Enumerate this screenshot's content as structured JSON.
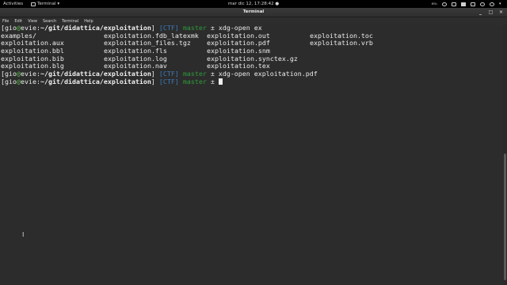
{
  "topbar": {
    "activities": "Activities",
    "app_name": "Terminal",
    "app_caret": "▾",
    "clock": "mar dic 12, 17:28:42",
    "clock_dot": "●",
    "keyboard": "en₁",
    "icons": [
      "network-icon",
      "volume-icon",
      "screenshot-icon",
      "display-icon",
      "user-icon",
      "power-icon",
      "menu-caret-icon"
    ]
  },
  "window": {
    "title": "Terminal",
    "controls": [
      "_",
      "□",
      "✕"
    ]
  },
  "menubar": [
    "File",
    "Edit",
    "View",
    "Search",
    "Terminal",
    "Help"
  ],
  "terminal": {
    "prompt": {
      "open": "[",
      "user": "gio",
      "at": "@",
      "host": "evie",
      "colon": ":",
      "path": "~/git/didattica/exploitation",
      "close": "]",
      "ctf": "[CTF]",
      "branch": "master",
      "symbol": "±"
    },
    "commands": [
      "xdg-open ex",
      "xdg-open exploitation.pdf"
    ],
    "completions": [
      [
        "examples/",
        "exploitation.fdb_latexmk",
        "exploitation.out",
        "exploitation.toc"
      ],
      [
        "exploitation.aux",
        "exploitation_files.tgz",
        "exploitation.pdf",
        "exploitation.vrb"
      ],
      [
        "exploitation.bbl",
        "exploitation.fls",
        "exploitation.snm",
        ""
      ],
      [
        "exploitation.bib",
        "exploitation.log",
        "exploitation.synctex.gz",
        ""
      ],
      [
        "exploitation.blg",
        "exploitation.nav",
        "exploitation.tex",
        ""
      ]
    ]
  },
  "pointer": "I"
}
